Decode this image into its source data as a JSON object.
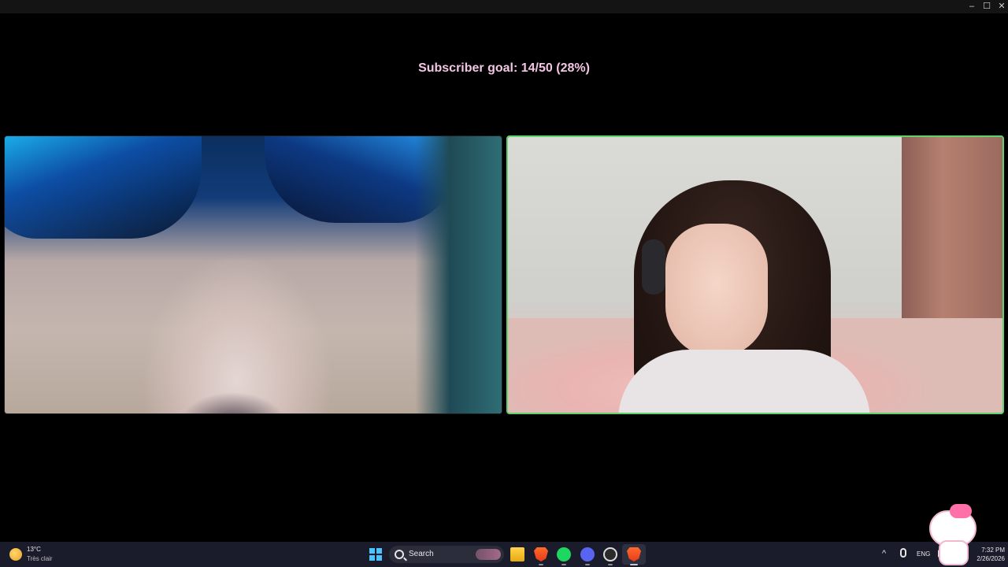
{
  "window": {
    "controls": {
      "minimize": "–",
      "maximize": "☐",
      "close": "✕"
    }
  },
  "overlay": {
    "goal_text": "Subscriber goal: 14/50 (28%)",
    "goal_current": 14,
    "goal_target": 50,
    "goal_percent": 28,
    "text_color": "#f2c6e3"
  },
  "call": {
    "active_speaker_border": "#5fd16d",
    "tiles": [
      {
        "participant": "left-participant",
        "speaking": false
      },
      {
        "participant": "right-participant",
        "speaking": true
      }
    ]
  },
  "taskbar": {
    "weather": {
      "temp": "13°C",
      "condition": "Très clair"
    },
    "search": {
      "label": "Search"
    },
    "pinned_apps": [
      "file-explorer-icon",
      "brave-icon",
      "spotify-icon",
      "discord-icon",
      "obs-icon",
      "brave-icon"
    ],
    "tray": {
      "chevron": "^",
      "lang": "ENG"
    },
    "clock": {
      "time": "7:32 PM",
      "date": "2/26/2026"
    }
  }
}
